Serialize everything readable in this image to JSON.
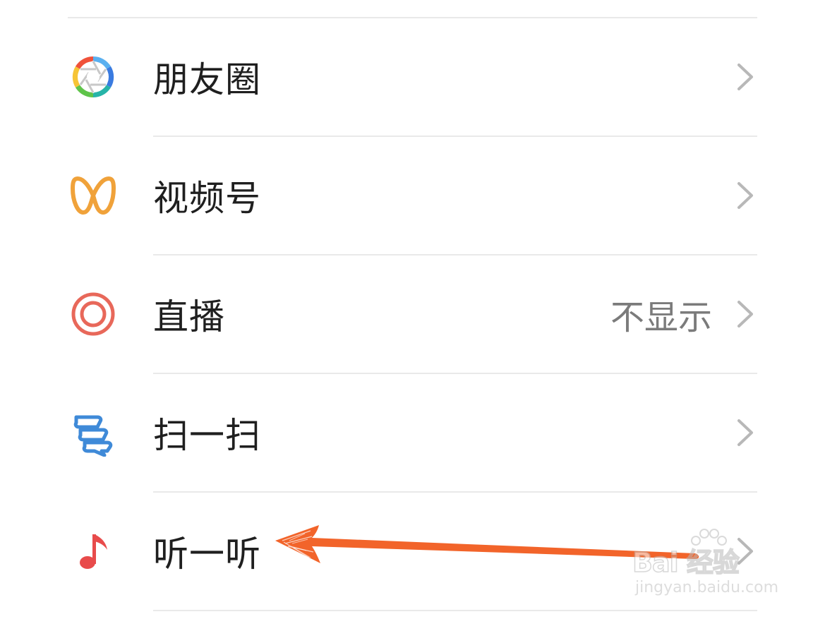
{
  "menu": {
    "items": [
      {
        "label": "朋友圈",
        "value": "",
        "icon": "moments-aperture-icon"
      },
      {
        "label": "视频号",
        "value": "",
        "icon": "channels-butterfly-icon"
      },
      {
        "label": "直播",
        "value": "不显示",
        "icon": "live-circle-icon"
      },
      {
        "label": "扫一扫",
        "value": "",
        "icon": "scan-chat-icon"
      },
      {
        "label": "听一听",
        "value": "",
        "icon": "music-note-icon"
      }
    ]
  },
  "colors": {
    "label": "#1f1f1f",
    "value": "#7b7b7b",
    "chevron": "#b8b8b8",
    "divider": "#e9e9e9",
    "channels": "#f0a23a",
    "live": "#e8685a",
    "scan": "#3f8ad8",
    "music": "#e84b4b",
    "annotation_arrow": "#f2642a"
  },
  "watermark": {
    "logo_text": "Bai 经验",
    "url_text": "jingyan.baidu.com"
  }
}
